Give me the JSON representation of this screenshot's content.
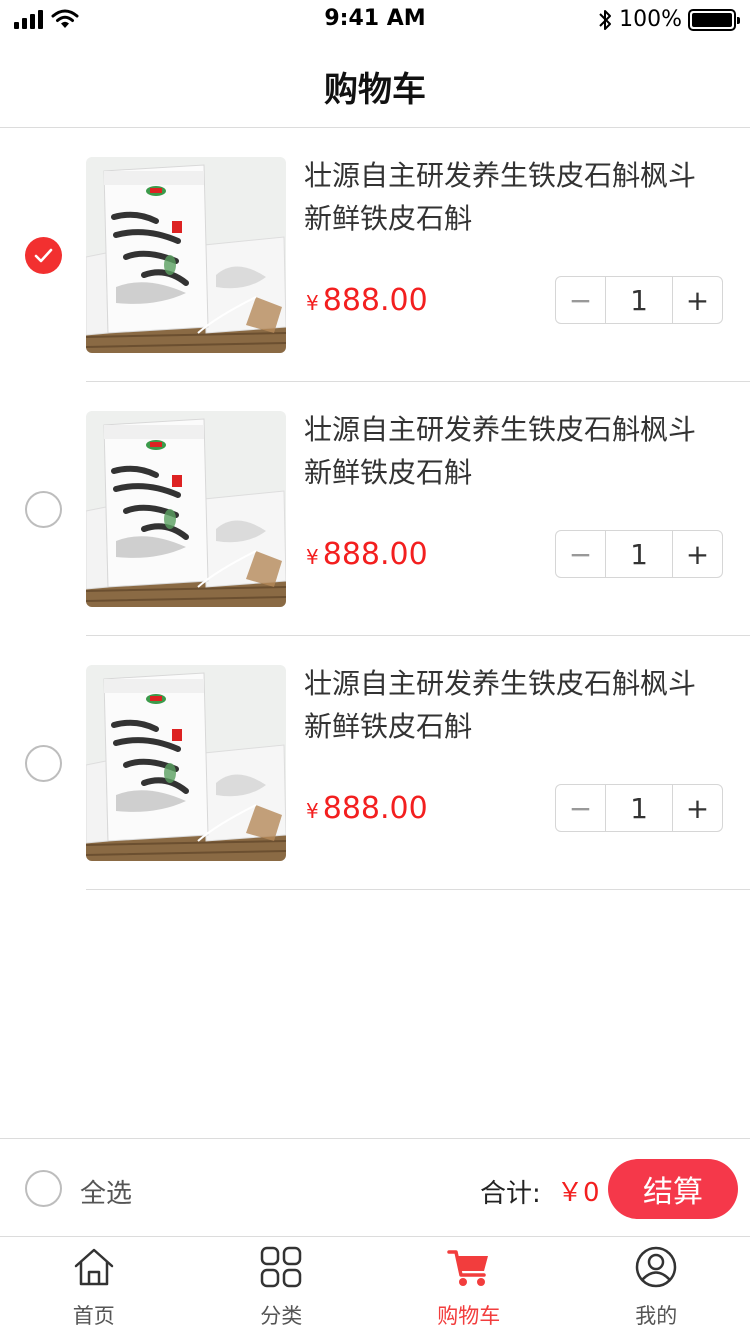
{
  "status_bar": {
    "time": "9:41 AM",
    "battery_percent": "100%",
    "battery_level": 1.0
  },
  "nav": {
    "title": "购物车"
  },
  "cart": {
    "items": [
      {
        "title": "壮源自主研发养生铁皮石斛枫斗新鲜铁皮石斛",
        "currency": "¥",
        "price": "888.00",
        "quantity": "1",
        "minus": "−",
        "plus": "+",
        "checked": true,
        "image_icon": "product-package-image"
      },
      {
        "title": "壮源自主研发养生铁皮石斛枫斗新鲜铁皮石斛",
        "currency": "¥",
        "price": "888.00",
        "quantity": "1",
        "minus": "−",
        "plus": "+",
        "checked": false,
        "image_icon": "product-package-image"
      },
      {
        "title": "壮源自主研发养生铁皮石斛枫斗新鲜铁皮石斛",
        "currency": "¥",
        "price": "888.00",
        "quantity": "1",
        "minus": "−",
        "plus": "+",
        "checked": false,
        "image_icon": "product-package-image"
      }
    ]
  },
  "checkout": {
    "select_all": "全选",
    "total_label": "合计:",
    "total_value": "￥0",
    "button": "结算"
  },
  "tabs": [
    {
      "label": "首页",
      "icon": "home-icon",
      "active": false
    },
    {
      "label": "分类",
      "icon": "category-grid-icon",
      "active": false
    },
    {
      "label": "购物车",
      "icon": "cart-icon",
      "active": true
    },
    {
      "label": "我的",
      "icon": "user-icon",
      "active": false
    }
  ],
  "colors": {
    "accent": "#f23030",
    "price": "#f31f1f",
    "checkout_button": "#f5384a",
    "divider": "#dcdcdc"
  }
}
